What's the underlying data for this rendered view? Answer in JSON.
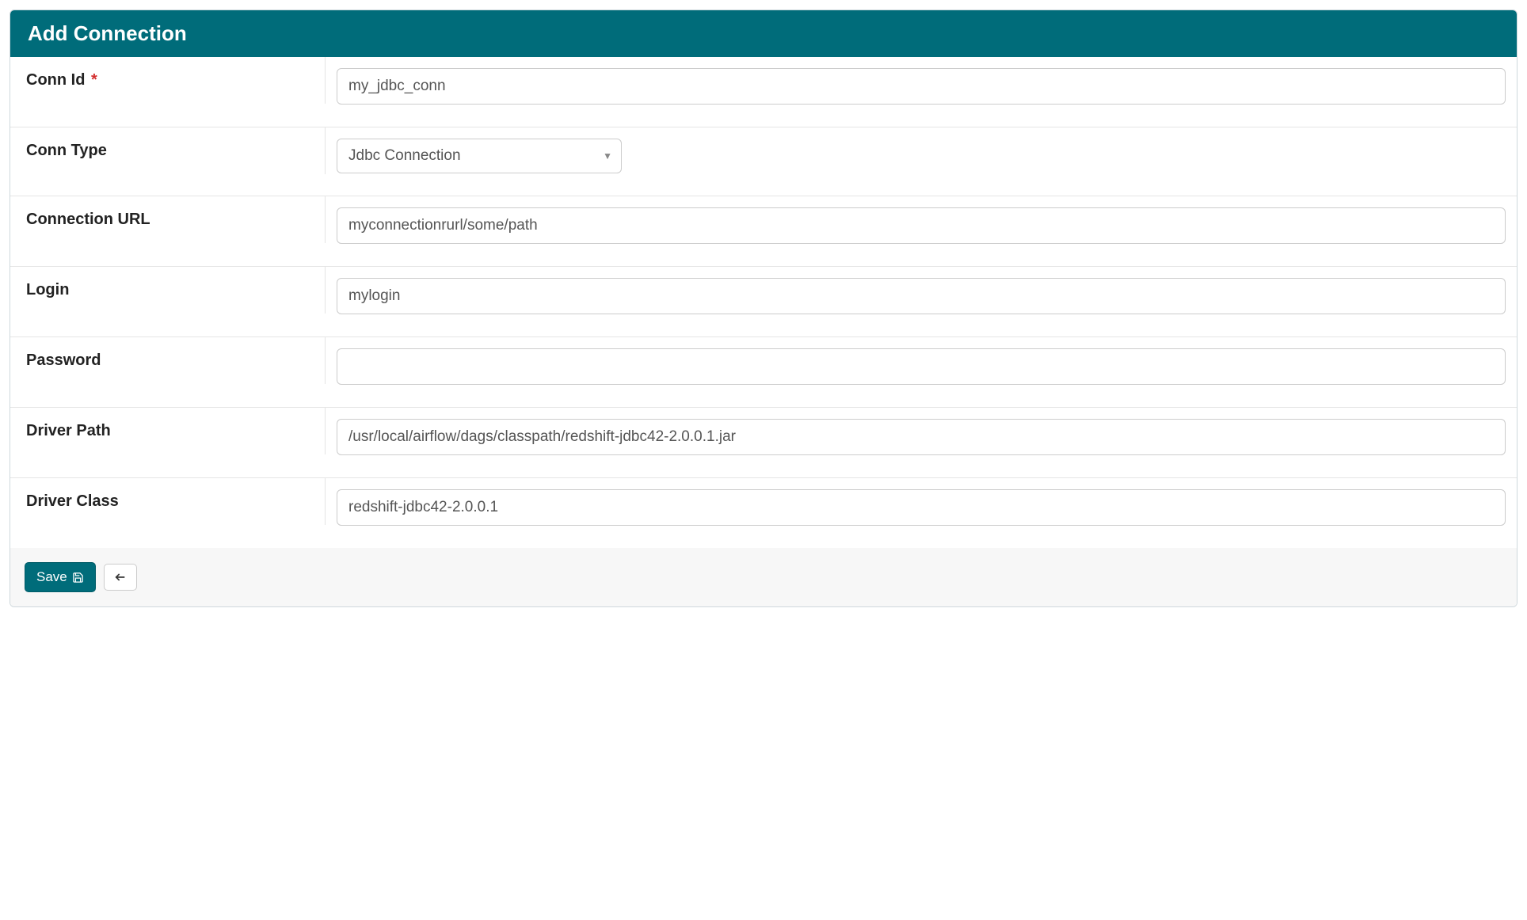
{
  "header": {
    "title": "Add Connection"
  },
  "fields": {
    "conn_id": {
      "label": "Conn Id",
      "required_marker": "*",
      "value": "my_jdbc_conn"
    },
    "conn_type": {
      "label": "Conn Type",
      "value": "Jdbc Connection"
    },
    "connection_url": {
      "label": "Connection URL",
      "value": "myconnectionrurl/some/path"
    },
    "login": {
      "label": "Login",
      "value": "mylogin"
    },
    "password": {
      "label": "Password",
      "value": ""
    },
    "driver_path": {
      "label": "Driver Path",
      "value": "/usr/local/airflow/dags/classpath/redshift-jdbc42-2.0.0.1.jar"
    },
    "driver_class": {
      "label": "Driver Class",
      "value": "redshift-jdbc42-2.0.0.1"
    }
  },
  "footer": {
    "save_label": "Save"
  }
}
